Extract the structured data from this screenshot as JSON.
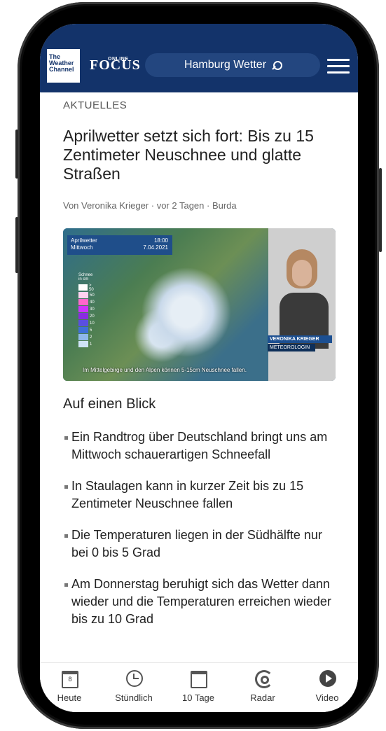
{
  "header": {
    "logo_twc_lines": [
      "The",
      "Weather",
      "Channel"
    ],
    "logo_focus": "FOCUS",
    "logo_online": "ONLINE",
    "search_label": "Hamburg Wetter"
  },
  "article": {
    "category": "AKTUELLES",
    "title": "Aprilwetter setzt sich fort: Bis zu 15 Zentimeter Neuschnee und glatte Straßen",
    "byline": "Von Veronika Krieger · vor 2 Tagen · Burda",
    "video": {
      "header_left": "Aprilwetter",
      "header_left_sub": "Mittwoch",
      "header_right": "18:00",
      "header_right_sub": "7.04.2021",
      "legend_title": "Schnee in cm",
      "legend_values": [
        "> 50",
        "50",
        "40",
        "30",
        "20",
        "10",
        "5",
        "2",
        "1"
      ],
      "legend_colors": [
        "#ffffff",
        "#ffd2f0",
        "#ff66cc",
        "#cc33ff",
        "#8a2be2",
        "#5a4fe0",
        "#3f6fd8",
        "#8fb7ea",
        "#cfe3f7"
      ],
      "presenter_name": "VERONIKA KRIEGER",
      "presenter_role": "METEOROLOGIN",
      "caption": "Im Mittelgebirge und den Alpen können 5-15cm Neuschnee fallen."
    },
    "summary_heading": "Auf einen Blick",
    "bullets": [
      "Ein Randtrog über Deutschland bringt uns am Mittwoch schauerartigen Schneefall",
      "In Staulagen kann in kurzer Zeit bis zu 15 Zentimeter Neuschnee fallen",
      "Die Temperaturen liegen in der Südhälfte nur bei 0 bis 5 Grad",
      "Am Donnerstag beruhigt sich das Wetter dann wieder und die Temperaturen erreichen wieder bis zu 10 Grad"
    ]
  },
  "nav": {
    "items": [
      {
        "label": "Heute",
        "icon": "calendar-day-icon",
        "day": "8"
      },
      {
        "label": "Stündlich",
        "icon": "clock-icon"
      },
      {
        "label": "10 Tage",
        "icon": "calendar-icon"
      },
      {
        "label": "Radar",
        "icon": "radar-icon"
      },
      {
        "label": "Video",
        "icon": "play-icon"
      }
    ]
  },
  "colors": {
    "header_bg": "#13336a",
    "search_bg": "#23467f",
    "text": "#222222"
  }
}
